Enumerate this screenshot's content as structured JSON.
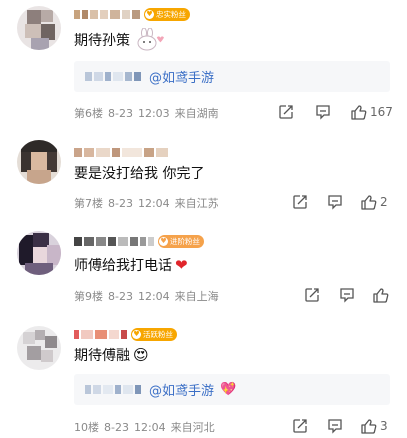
{
  "comments": [
    {
      "fan_badge": "忠实粉丝",
      "badge_color": "#f7a600",
      "text": "期待孙策",
      "text_suffix_icon": "bunny-sticker-icon",
      "quote_at": "@如鸢手游",
      "floor": "第6楼",
      "date": "8-23",
      "time": "12:03",
      "location": "来自湖南",
      "likes": "167"
    },
    {
      "fan_badge": "",
      "text": "要是没打给我 你完了",
      "floor": "第7楼",
      "date": "8-23",
      "time": "12:04",
      "location": "来自江苏",
      "likes": "2"
    },
    {
      "fan_badge": "进阶粉丝",
      "badge_color": "#f5a24b",
      "text": "师傅给我打电话",
      "text_suffix_icon": "red-heart-icon",
      "floor": "第9楼",
      "date": "8-23",
      "time": "12:04",
      "location": "来自上海",
      "likes": ""
    },
    {
      "fan_badge": "活跃粉丝",
      "badge_color": "#f7a600",
      "text": "期待傅融",
      "text_suffix_icon": "heart-eyes-emoji-icon",
      "quote_at": "@如鸢手游",
      "quote_suffix_icon": "sparkling-heart-icon",
      "floor": "10楼",
      "date": "8-23",
      "time": "12:04",
      "location": "来自河北",
      "likes": "3"
    }
  ],
  "icons": {
    "share": "share-icon",
    "comment": "comment-icon",
    "like": "like-icon"
  },
  "colors": {
    "link": "#3b6fc6",
    "meta": "#8a8a8a",
    "heart": "#e0252b"
  }
}
